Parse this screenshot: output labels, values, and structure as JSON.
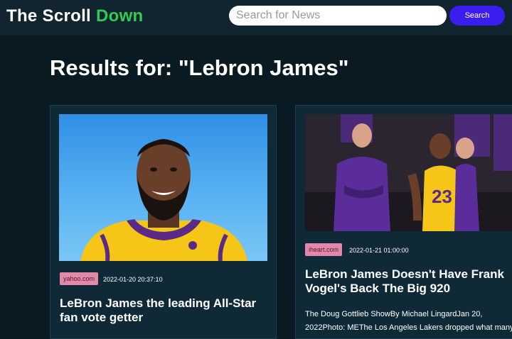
{
  "header": {
    "brand_main": "The Scroll ",
    "brand_accent": "Down",
    "search_placeholder": "Search for News",
    "search_button_label": "Search"
  },
  "results": {
    "title": "Results for: \"Lebron James\""
  },
  "colors": {
    "accent_green": "#2ecc52",
    "search_button": "#3a1ef0",
    "badge_bg": "#e08aa8",
    "card_bg": "#0f2a36",
    "page_bg": "#0a1a22"
  },
  "articles": [
    {
      "source": "yahoo.com",
      "date": "2022-01-20 20:37:10",
      "title": "LeBron James the leading All-Star fan vote getter",
      "description": ""
    },
    {
      "source": "iheart.com",
      "date": "2022-01-21 01:00:00",
      "title": "LeBron James Doesn't Have Frank Vogel's Back The Big 920",
      "description": "The Doug Gottlieb ShowBy Michael LingardJan 20, 2022Photo: METhe Los Angeles Lakers dropped what many"
    }
  ]
}
